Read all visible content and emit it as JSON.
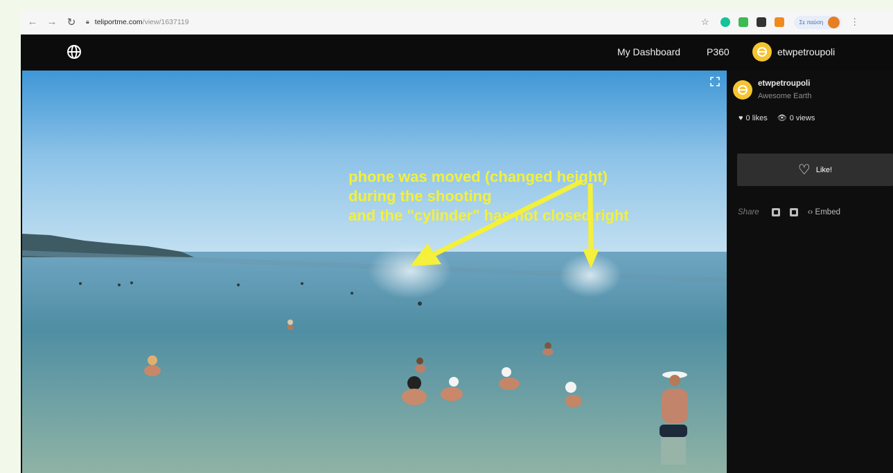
{
  "browser": {
    "url_host": "teliportme.com",
    "url_path": "/view/1637119",
    "profile_label": "Σε παύση"
  },
  "header": {
    "nav_dashboard": "My Dashboard",
    "nav_p360": "P360",
    "username": "etwpetroupoli"
  },
  "panorama": {
    "annotation_lines": [
      "phone was moved (changed height)",
      "during the shooting",
      "and the \"cylinder\" has not closed right"
    ],
    "annotation_color": "#f4f03b"
  },
  "sidebar": {
    "author_name": "etwpetroupoli",
    "author_subtitle": "Awesome Earth",
    "likes_text": "0 likes",
    "views_text": "0 views",
    "like_button_label": "Like!",
    "share_label": "Share",
    "embed_label": "‹› Embed"
  },
  "colors": {
    "avatar": "#f5c431",
    "header_bg": "#0c0c0c",
    "like_button_bg": "#2f2f2f"
  }
}
